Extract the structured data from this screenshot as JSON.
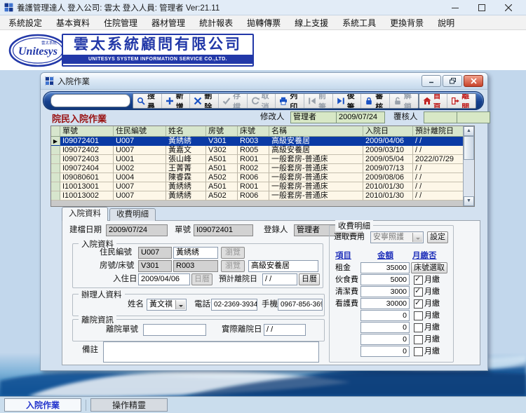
{
  "window": {
    "title": "養護管理達人 登入公司: 雲太 登入人員: 管理者 Ver:21.11"
  },
  "menu": {
    "items": [
      "系統設定",
      "基本資料",
      "住院管理",
      "器材管理",
      "統計報表",
      "拋轉傳票",
      "線上支援",
      "系統工具",
      "更換背景",
      "說明"
    ]
  },
  "header": {
    "logo_text": "Unitesys",
    "logo_small_text": "雲太系統",
    "company_zh": "雲太系統顧問有限公司",
    "company_en": "UNITESYS SYSTEM INFORMATION SERVICE CO.,LTD."
  },
  "doc_window": {
    "title": "入院作業",
    "toolbar": {
      "search_value": "",
      "buttons": [
        {
          "name": "search-button",
          "label": "搜尋",
          "icon": "search-icon",
          "enabled": true,
          "color": "#1a52c4"
        },
        {
          "name": "add-button",
          "label": "新增",
          "icon": "plus-icon",
          "enabled": true,
          "color": "#1a52c4"
        },
        {
          "name": "delete-button",
          "label": "刪除",
          "icon": "x-icon",
          "enabled": true,
          "color": "#1a52c4"
        },
        {
          "name": "save-button",
          "label": "存檔",
          "icon": "check-icon",
          "enabled": false,
          "color": "#1a52c4"
        },
        {
          "name": "cancel-button",
          "label": "取消",
          "icon": "undo-icon",
          "enabled": false,
          "color": "#1a52c4"
        },
        {
          "name": "print-button",
          "label": "列印",
          "icon": "printer-icon",
          "enabled": true,
          "color": "#1a52c4"
        },
        {
          "name": "prev-record-button",
          "label": "前筆",
          "icon": "prev-icon",
          "enabled": false,
          "color": "#1a52c4"
        },
        {
          "name": "next-record-button",
          "label": "後筆",
          "icon": "next-icon",
          "enabled": true,
          "color": "#1a52c4"
        },
        {
          "name": "audit-button",
          "label": "審核",
          "icon": "lock-icon",
          "enabled": true,
          "color": "#1a52c4"
        },
        {
          "name": "unlock-button",
          "label": "解鎖",
          "icon": "unlock-icon",
          "enabled": false,
          "color": "#1a52c4"
        }
      ],
      "nav_buttons": [
        {
          "name": "home-button",
          "label": "首頁",
          "icon": "home-icon",
          "enabled": true,
          "color": "#c01f1f"
        },
        {
          "name": "exit-button",
          "label": "離開",
          "icon": "exit-icon",
          "enabled": true,
          "color": "#c01f1f"
        }
      ]
    },
    "subheader": {
      "title": "院民入院作業",
      "modifier_label": "修改人",
      "modifier_name": "管理者",
      "modifier_date": "2009/07/24",
      "reviewer_label": "覆核人"
    },
    "table": {
      "headers": [
        "單號",
        "住民編號",
        "姓名",
        "房號",
        "床號",
        "名稱",
        "入院日",
        "預計離院日"
      ],
      "rows": [
        {
          "selected": true,
          "cells": [
            "I09072401",
            "U007",
            "黃綉綉",
            "V301",
            "R003",
            "高級安養居",
            "2009/04/06",
            "/ /"
          ]
        },
        {
          "selected": false,
          "cells": [
            "I09072402",
            "U007",
            "黃嘉文",
            "V302",
            "R005",
            "高級安養居",
            "2009/03/10",
            "/ /"
          ]
        },
        {
          "selected": false,
          "cells": [
            "I09072403",
            "U001",
            "張山峰",
            "A501",
            "R001",
            "一般套房-普通床",
            "2009/05/04",
            "2022/07/29"
          ]
        },
        {
          "selected": false,
          "cells": [
            "I09072404",
            "U002",
            "王菁菁",
            "A501",
            "R002",
            "一般套房-普通床",
            "2009/07/13",
            "/ /"
          ]
        },
        {
          "selected": false,
          "cells": [
            "I09080601",
            "U004",
            "陳睿霖",
            "A502",
            "R006",
            "一般套房-普通床",
            "2009/08/06",
            "/ /"
          ]
        },
        {
          "selected": false,
          "cells": [
            "I10013001",
            "U007",
            "黃綉綉",
            "A501",
            "R001",
            "一般套房-普通床",
            "2010/01/30",
            "/ /"
          ]
        },
        {
          "selected": false,
          "cells": [
            "I10013002",
            "U007",
            "黃綉綉",
            "A502",
            "R006",
            "一般套房-普通床",
            "2010/01/30",
            "/ /"
          ]
        }
      ]
    },
    "tabs": [
      {
        "label": "入院資料",
        "active": true
      },
      {
        "label": "收費明細",
        "active": false
      }
    ],
    "detail": {
      "created_label": "建檔日期",
      "created_value": "2009/07/24",
      "docno_label": "單號",
      "docno_value": "I09072401",
      "registrar_label": "登錄人",
      "registrar_value": "管理者",
      "admission_group": {
        "title": "入院資料",
        "resident_label": "住民編號",
        "resident_id": "U007",
        "resident_name": "黃綉綉",
        "browse_label": "瀏覽",
        "room_label": "房號/床號",
        "room": "V301",
        "bed": "R003",
        "room_name": "高級安養居",
        "checkin_label": "入住日",
        "checkin_date": "2009/04/06",
        "calendar_label": "日曆",
        "expected_leave_label": "預計離院日",
        "expected_leave_date": "/ /"
      },
      "handler_group": {
        "title": "辦理人資料",
        "name_label": "姓名",
        "name_value": "黃文祺",
        "phone_label": "電話",
        "phone_value": "02-2369-3934",
        "mobile_label": "手機",
        "mobile_value": "0967-856-369"
      },
      "discharge_group": {
        "title": "離院資訊",
        "docno_label": "離院單號",
        "docno_value": "",
        "date_label": "實際離院日",
        "date_value": "/ /"
      },
      "note_label": "備註",
      "note_value": ""
    },
    "fees": {
      "title": "收費明細",
      "select_label": "選取費用",
      "select_value": "安寧照護",
      "set_label": "設定",
      "col_item": "項目",
      "col_amount": "金額",
      "col_monthly": "月繳否",
      "monthly_label": "月繳",
      "bed_select_label": "床號選取",
      "rows": [
        {
          "item": "租金",
          "amount": "35000",
          "type": "button"
        },
        {
          "item": "伙食費",
          "amount": "5000",
          "type": "checked"
        },
        {
          "item": "清潔費",
          "amount": "3000",
          "type": "checked"
        },
        {
          "item": "看護費",
          "amount": "30000",
          "type": "checked"
        },
        {
          "item": "",
          "amount": "0",
          "type": "unchecked"
        },
        {
          "item": "",
          "amount": "0",
          "type": "unchecked"
        },
        {
          "item": "",
          "amount": "0",
          "type": "unchecked"
        },
        {
          "item": "",
          "amount": "0",
          "type": "unchecked"
        }
      ]
    }
  },
  "taskbar": {
    "tabs": [
      {
        "label": "入院作業",
        "active": true
      },
      {
        "label": "操作精靈",
        "active": false
      }
    ]
  },
  "colors": {
    "accent_blue": "#2238a8",
    "title_red": "#911111",
    "selected_row": "#0a3aa5",
    "field_green": "#d8e8c6",
    "nav_red": "#c01f1f"
  }
}
